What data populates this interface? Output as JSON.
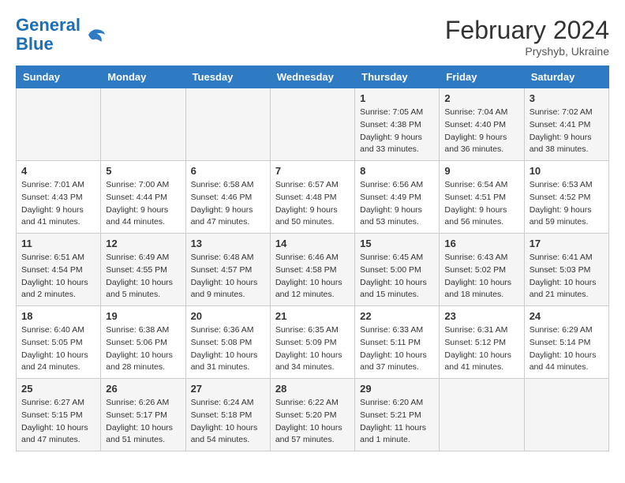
{
  "logo": {
    "line1": "General",
    "line2": "Blue"
  },
  "title": "February 2024",
  "subtitle": "Pryshyb, Ukraine",
  "days_header": [
    "Sunday",
    "Monday",
    "Tuesday",
    "Wednesday",
    "Thursday",
    "Friday",
    "Saturday"
  ],
  "weeks": [
    [
      {
        "day": "",
        "info": ""
      },
      {
        "day": "",
        "info": ""
      },
      {
        "day": "",
        "info": ""
      },
      {
        "day": "",
        "info": ""
      },
      {
        "day": "1",
        "info": "Sunrise: 7:05 AM\nSunset: 4:38 PM\nDaylight: 9 hours\nand 33 minutes."
      },
      {
        "day": "2",
        "info": "Sunrise: 7:04 AM\nSunset: 4:40 PM\nDaylight: 9 hours\nand 36 minutes."
      },
      {
        "day": "3",
        "info": "Sunrise: 7:02 AM\nSunset: 4:41 PM\nDaylight: 9 hours\nand 38 minutes."
      }
    ],
    [
      {
        "day": "4",
        "info": "Sunrise: 7:01 AM\nSunset: 4:43 PM\nDaylight: 9 hours\nand 41 minutes."
      },
      {
        "day": "5",
        "info": "Sunrise: 7:00 AM\nSunset: 4:44 PM\nDaylight: 9 hours\nand 44 minutes."
      },
      {
        "day": "6",
        "info": "Sunrise: 6:58 AM\nSunset: 4:46 PM\nDaylight: 9 hours\nand 47 minutes."
      },
      {
        "day": "7",
        "info": "Sunrise: 6:57 AM\nSunset: 4:48 PM\nDaylight: 9 hours\nand 50 minutes."
      },
      {
        "day": "8",
        "info": "Sunrise: 6:56 AM\nSunset: 4:49 PM\nDaylight: 9 hours\nand 53 minutes."
      },
      {
        "day": "9",
        "info": "Sunrise: 6:54 AM\nSunset: 4:51 PM\nDaylight: 9 hours\nand 56 minutes."
      },
      {
        "day": "10",
        "info": "Sunrise: 6:53 AM\nSunset: 4:52 PM\nDaylight: 9 hours\nand 59 minutes."
      }
    ],
    [
      {
        "day": "11",
        "info": "Sunrise: 6:51 AM\nSunset: 4:54 PM\nDaylight: 10 hours\nand 2 minutes."
      },
      {
        "day": "12",
        "info": "Sunrise: 6:49 AM\nSunset: 4:55 PM\nDaylight: 10 hours\nand 5 minutes."
      },
      {
        "day": "13",
        "info": "Sunrise: 6:48 AM\nSunset: 4:57 PM\nDaylight: 10 hours\nand 9 minutes."
      },
      {
        "day": "14",
        "info": "Sunrise: 6:46 AM\nSunset: 4:58 PM\nDaylight: 10 hours\nand 12 minutes."
      },
      {
        "day": "15",
        "info": "Sunrise: 6:45 AM\nSunset: 5:00 PM\nDaylight: 10 hours\nand 15 minutes."
      },
      {
        "day": "16",
        "info": "Sunrise: 6:43 AM\nSunset: 5:02 PM\nDaylight: 10 hours\nand 18 minutes."
      },
      {
        "day": "17",
        "info": "Sunrise: 6:41 AM\nSunset: 5:03 PM\nDaylight: 10 hours\nand 21 minutes."
      }
    ],
    [
      {
        "day": "18",
        "info": "Sunrise: 6:40 AM\nSunset: 5:05 PM\nDaylight: 10 hours\nand 24 minutes."
      },
      {
        "day": "19",
        "info": "Sunrise: 6:38 AM\nSunset: 5:06 PM\nDaylight: 10 hours\nand 28 minutes."
      },
      {
        "day": "20",
        "info": "Sunrise: 6:36 AM\nSunset: 5:08 PM\nDaylight: 10 hours\nand 31 minutes."
      },
      {
        "day": "21",
        "info": "Sunrise: 6:35 AM\nSunset: 5:09 PM\nDaylight: 10 hours\nand 34 minutes."
      },
      {
        "day": "22",
        "info": "Sunrise: 6:33 AM\nSunset: 5:11 PM\nDaylight: 10 hours\nand 37 minutes."
      },
      {
        "day": "23",
        "info": "Sunrise: 6:31 AM\nSunset: 5:12 PM\nDaylight: 10 hours\nand 41 minutes."
      },
      {
        "day": "24",
        "info": "Sunrise: 6:29 AM\nSunset: 5:14 PM\nDaylight: 10 hours\nand 44 minutes."
      }
    ],
    [
      {
        "day": "25",
        "info": "Sunrise: 6:27 AM\nSunset: 5:15 PM\nDaylight: 10 hours\nand 47 minutes."
      },
      {
        "day": "26",
        "info": "Sunrise: 6:26 AM\nSunset: 5:17 PM\nDaylight: 10 hours\nand 51 minutes."
      },
      {
        "day": "27",
        "info": "Sunrise: 6:24 AM\nSunset: 5:18 PM\nDaylight: 10 hours\nand 54 minutes."
      },
      {
        "day": "28",
        "info": "Sunrise: 6:22 AM\nSunset: 5:20 PM\nDaylight: 10 hours\nand 57 minutes."
      },
      {
        "day": "29",
        "info": "Sunrise: 6:20 AM\nSunset: 5:21 PM\nDaylight: 11 hours\nand 1 minute."
      },
      {
        "day": "",
        "info": ""
      },
      {
        "day": "",
        "info": ""
      }
    ]
  ]
}
